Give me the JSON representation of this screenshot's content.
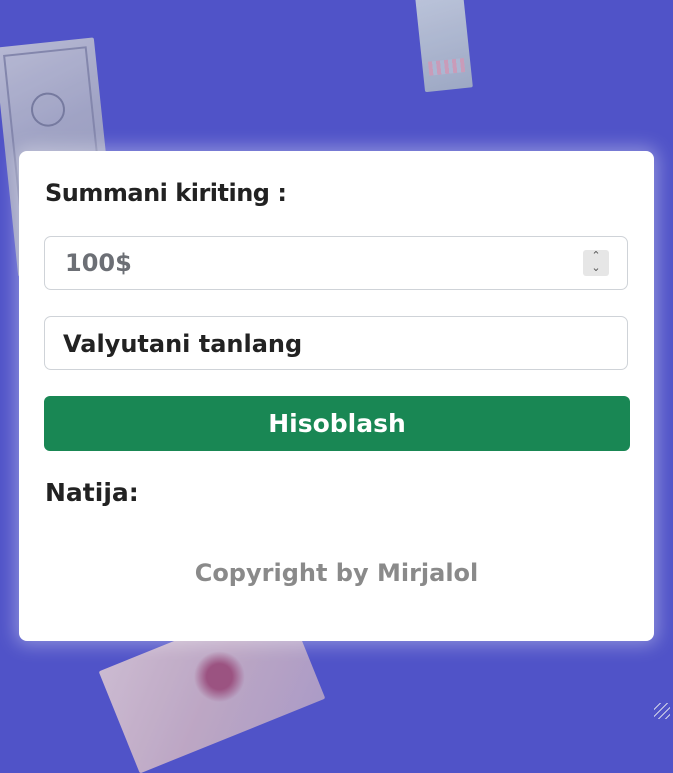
{
  "form": {
    "amount_label": "Summani kiriting :",
    "amount_placeholder": "100$",
    "currency_select": "Valyutani tanlang",
    "calculate_button": "Hisoblash",
    "result_label": "Natija:"
  },
  "footer": {
    "copyright": "Copyright by Mirjalol"
  },
  "colors": {
    "background": "#5053c8",
    "button": "#198754"
  }
}
